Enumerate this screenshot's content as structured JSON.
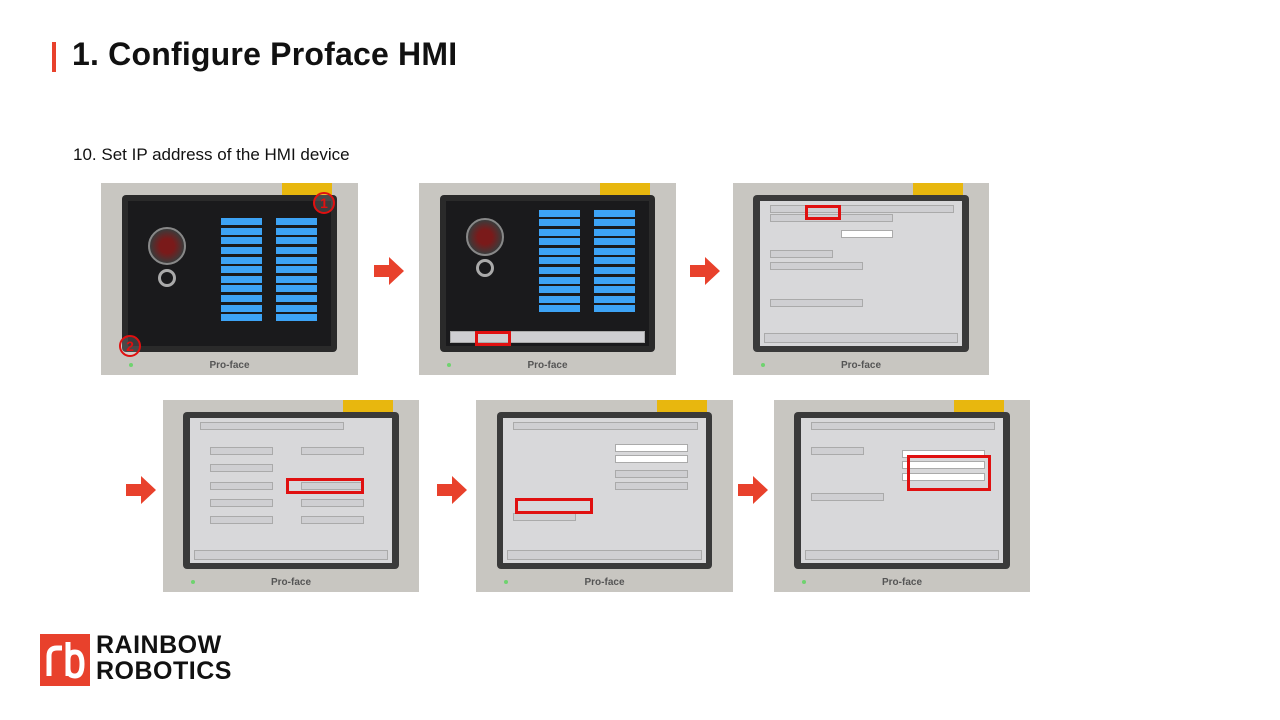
{
  "slide": {
    "title": "1. Configure Proface HMI",
    "step_text": "10. Set IP address of the HMI device"
  },
  "colors": {
    "accent": "#e8412c",
    "highlight": "#e01010",
    "bar_blue": "#3da3f5"
  },
  "photos": [
    {
      "brand": "Pro-face",
      "callouts": [
        "1",
        "2"
      ]
    },
    {
      "brand": "Pro-face"
    },
    {
      "brand": "Pro-face"
    },
    {
      "brand": "Pro-face"
    },
    {
      "brand": "Pro-face"
    },
    {
      "brand": "Pro-face"
    }
  ],
  "arrows": {
    "icon": "right-arrow-icon",
    "count": 5
  },
  "logo": {
    "line1": "RAINBOW",
    "line2": "ROBOTICS",
    "icon": "rb-logo-icon"
  }
}
